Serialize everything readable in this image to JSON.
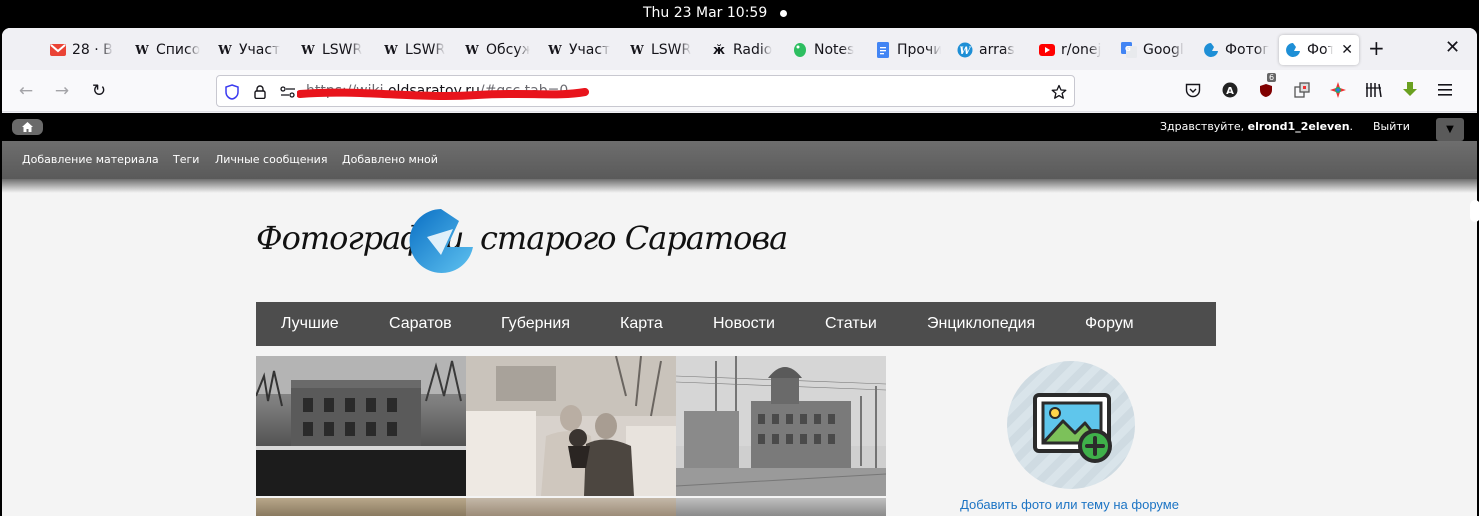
{
  "system": {
    "clock": "Thu 23 Mar  10:59"
  },
  "tabs": [
    {
      "label": "28 · B",
      "icon": "gmail-icon"
    },
    {
      "label": "Списо",
      "icon": "wikipedia-icon"
    },
    {
      "label": "Участ",
      "icon": "wikipedia-icon"
    },
    {
      "label": "LSWR",
      "icon": "wikipedia-icon"
    },
    {
      "label": "LSWR",
      "icon": "wikipedia-icon"
    },
    {
      "label": "Обсуж",
      "icon": "wikipedia-icon"
    },
    {
      "label": "Участ",
      "icon": "wikipedia-icon"
    },
    {
      "label": "LSWR",
      "icon": "wikipedia-icon"
    },
    {
      "label": "Radio",
      "icon": "radio-icon"
    },
    {
      "label": "Notes",
      "icon": "evernote-icon"
    },
    {
      "label": "Прочи",
      "icon": "google-docs-icon"
    },
    {
      "label": "arras",
      "icon": "wordpress-icon"
    },
    {
      "label": "r/onej",
      "icon": "youtube-icon"
    },
    {
      "label": "Googl",
      "icon": "google-translate-icon"
    },
    {
      "label": "Фотог",
      "icon": "oldsaratov-icon"
    },
    {
      "label": "Фот",
      "icon": "oldsaratov-icon",
      "active": true
    }
  ],
  "toolbar": {
    "url_prefix": "https://wiki.",
    "url_domain": "oldsaratov.ru",
    "url_suffix": "/#gsc.tab=0",
    "ublock_badge": "6"
  },
  "site": {
    "greeting_prefix": "Здравствуйте, ",
    "username": "elrond1_2eleven",
    "greeting_suffix": ".",
    "logout": "Выйти",
    "admin_links": [
      "Добавление материала",
      "Теги",
      "Личные сообщения",
      "Добавлено мной"
    ],
    "logo_left": "Фотографии",
    "logo_right": "старого Саратова",
    "nav": [
      "Лучшие",
      "Саратов",
      "Губерния",
      "Карта",
      "Новости",
      "Статьи",
      "Энциклопедия",
      "Форум"
    ],
    "add_link": "Добавить фото или тему на форуме",
    "colors": {
      "link": "#1c74c4",
      "nav_bg": "#4d4d4d",
      "logo_blue": "#1e8fd6",
      "redaction": "#e8141c"
    }
  }
}
